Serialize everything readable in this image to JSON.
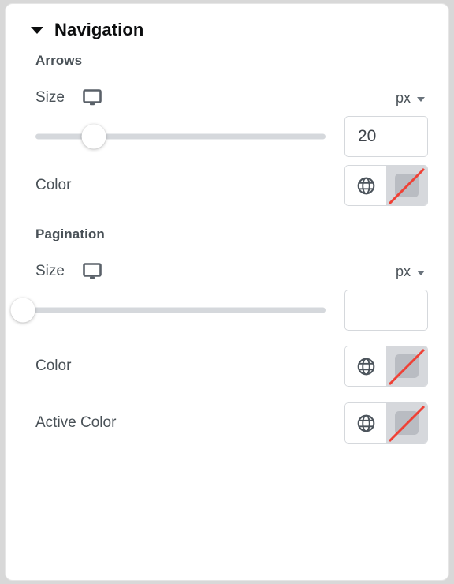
{
  "panel": {
    "header": {
      "title": "Navigation",
      "caret_icon": "chevron-down-icon",
      "expanded": true
    },
    "groups": [
      {
        "heading": "Arrows",
        "size_row": {
          "label": "Size",
          "device_icon": "desktop-monitor-icon",
          "unit": "px",
          "unit_caret_icon": "chevron-down-icon"
        },
        "slider": {
          "value": "20",
          "percent": 20,
          "handle_icon": "slider-handle"
        },
        "color_row": {
          "label": "Color",
          "globe_icon": "globe-icon",
          "swatch_icon": "no-color-swatch-icon",
          "swatch_value": "none"
        }
      },
      {
        "heading": "Pagination",
        "size_row": {
          "label": "Size",
          "device_icon": "desktop-monitor-icon",
          "unit": "px",
          "unit_caret_icon": "chevron-down-icon"
        },
        "slider": {
          "value": "",
          "percent": 0,
          "handle_icon": "slider-handle"
        },
        "color_row": {
          "label": "Color",
          "globe_icon": "globe-icon",
          "swatch_icon": "no-color-swatch-icon",
          "swatch_value": "none"
        },
        "active_color_row": {
          "label": "Active Color",
          "globe_icon": "globe-icon",
          "swatch_icon": "no-color-swatch-icon",
          "swatch_value": "none"
        }
      }
    ]
  },
  "colors": {
    "panel_background": "#ffffff",
    "page_background": "#d8d8d8",
    "title_text": "#0c0d0e",
    "label_text": "#495157",
    "slider_track": "#d5d8dc",
    "border": "#d5d8dc",
    "swatch_fill": "#b9bcc2",
    "swatch_slash": "#ef4136"
  }
}
